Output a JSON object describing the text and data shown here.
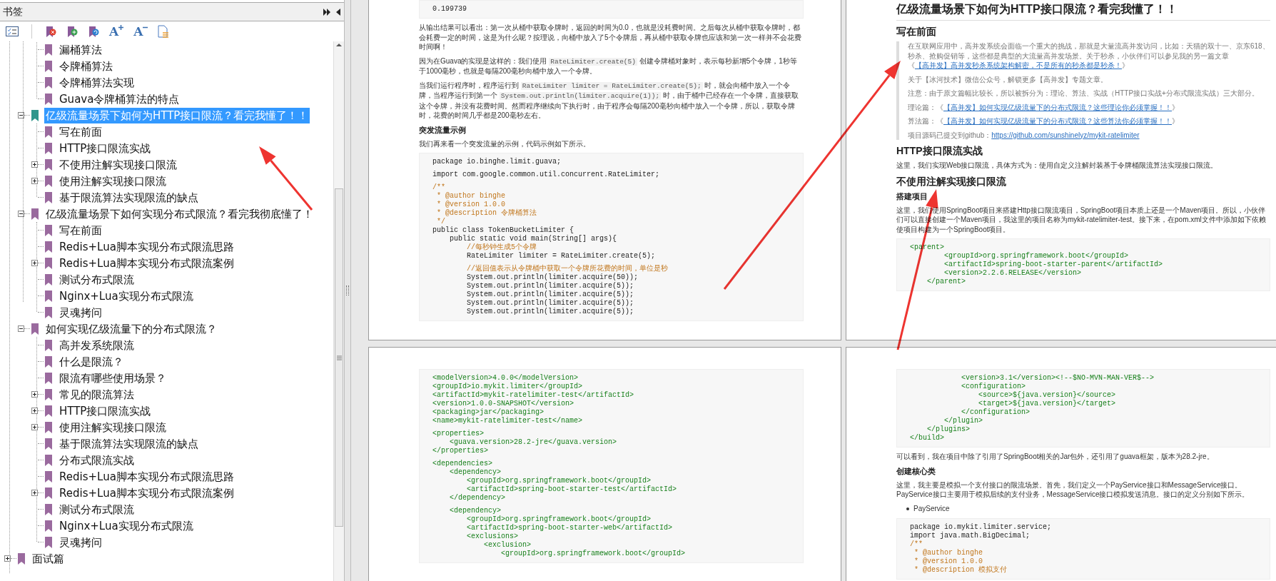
{
  "sidebar": {
    "title": "书签",
    "toolbar": {
      "font_larger_label": "A",
      "font_smaller_label": "A"
    }
  },
  "bookmarks": {
    "continued_items": [
      {
        "label": "漏桶算法",
        "selected": false
      },
      {
        "label": "令牌桶算法",
        "selected": false
      },
      {
        "label": "令牌桶算法实现",
        "selected": false
      },
      {
        "label": "Guava令牌桶算法的特点",
        "selected": false
      }
    ],
    "items": [
      {
        "label": "亿级流量场景下如何为HTTP接口限流？看完我懂了！！",
        "selected": true,
        "expanded": true,
        "children": [
          {
            "label": "写在前面",
            "selected": false
          },
          {
            "label": "HTTP接口限流实战",
            "selected": false
          },
          {
            "label": "不使用注解实现接口限流",
            "selected": false,
            "expanded": false
          },
          {
            "label": "使用注解实现接口限流",
            "selected": false,
            "expanded": false
          },
          {
            "label": "基于限流算法实现限流的缺点",
            "selected": false
          }
        ]
      },
      {
        "label": "亿级流量场景下如何实现分布式限流？看完我彻底懂了！",
        "selected": false,
        "expanded": true,
        "children": [
          {
            "label": "写在前面",
            "selected": false
          },
          {
            "label": "Redis+Lua脚本实现分布式限流思路",
            "selected": false
          },
          {
            "label": "Redis+Lua脚本实现分布式限流案例",
            "selected": false,
            "expanded": false
          },
          {
            "label": "测试分布式限流",
            "selected": false
          },
          {
            "label": "Nginx+Lua实现分布式限流",
            "selected": false
          },
          {
            "label": "灵魂拷问",
            "selected": false
          }
        ]
      },
      {
        "label": "如何实现亿级流量下的分布式限流？",
        "selected": false,
        "expanded": true,
        "children": [
          {
            "label": "高并发系统限流",
            "selected": false
          },
          {
            "label": "什么是限流？",
            "selected": false
          },
          {
            "label": "限流有哪些使用场景？",
            "selected": false
          },
          {
            "label": "常见的限流算法",
            "selected": false,
            "expanded": false
          },
          {
            "label": "HTTP接口限流实战",
            "selected": false,
            "expanded": false
          },
          {
            "label": "使用注解实现接口限流",
            "selected": false,
            "expanded": false
          },
          {
            "label": "基于限流算法实现限流的缺点",
            "selected": false
          },
          {
            "label": "分布式限流实战",
            "selected": false
          },
          {
            "label": "Redis+Lua脚本实现分布式限流思路",
            "selected": false
          },
          {
            "label": "Redis+Lua脚本实现分布式限流案例",
            "selected": false,
            "expanded": false
          },
          {
            "label": "测试分布式限流",
            "selected": false
          },
          {
            "label": "Nginx+Lua实现分布式限流",
            "selected": false
          },
          {
            "label": "灵魂拷问",
            "selected": false
          }
        ]
      }
    ],
    "outer_items": [
      {
        "label": "面试篇",
        "selected": false,
        "expanded": false
      }
    ]
  },
  "pages": [
    {
      "blocks": [
        {
          "kind": "code",
          "groups": [
            [
              {
                "text": "0.199739",
                "kind": "code"
              }
            ]
          ]
        },
        {
          "kind": "paragraph",
          "parts": [
            {
              "kind": "text",
              "text": "从输出结果可以看出：第一次从桶中获取令牌时，返回的时间为0.0，也就是没耗费时间。之后每次从桶中获取令牌时，都会耗费一定的时间，这是为什么呢？按理说，向桶中放入了5个令牌后，再从桶中获取令牌也应该和第一次一样并不会花费时间啊！"
            }
          ]
        },
        {
          "kind": "paragraph",
          "parts": [
            {
              "kind": "text",
              "text": "因为在Guava的实现是这样的：我们使用 "
            },
            {
              "kind": "code",
              "text": "RateLimiter.create(5)"
            },
            {
              "kind": "text",
              "text": " 创建令牌桶对象时，表示每秒新增5个令牌，1秒等于1000毫秒，也就是每隔200毫秒向桶中放入一个令牌。"
            }
          ]
        },
        {
          "kind": "paragraph",
          "parts": [
            {
              "kind": "text",
              "text": "当我们运行程序时，程序运行到 "
            },
            {
              "kind": "code",
              "text": "RateLimiter limiter = RateLimiter.create(5);"
            },
            {
              "kind": "text",
              "text": " 时，就会向桶中放入一个令牌，当程序运行到第一个 "
            },
            {
              "kind": "code",
              "text": "System.out.println(limiter.acquire(1));"
            },
            {
              "kind": "text",
              "text": " 时，由于桶中已经存在一个令牌，直接获取这个令牌，并没有花费时间。然而程序继续向下执行时，由于程序会每隔200毫秒向桶中放入一个令牌，所以，获取令牌时，花费的时间几乎都是200毫秒左右。"
            }
          ]
        },
        {
          "kind": "subheading",
          "text": "突发流量示例"
        },
        {
          "kind": "paragraph",
          "parts": [
            {
              "kind": "text",
              "text": "我们再来看一个突发流量的示例，代码示例如下所示。"
            }
          ]
        },
        {
          "kind": "code",
          "groups": [
            [
              {
                "text": "package io.binghe.limit.guava;",
                "kind": "code"
              }
            ],
            [
              {
                "text": "import com.google.common.util.concurrent.RateLimiter;",
                "kind": "code"
              }
            ],
            [
              {
                "text": "/**",
                "kind": "comment"
              },
              {
                "text": " * @author binghe",
                "kind": "comment"
              },
              {
                "text": " * @version 1.0.0",
                "kind": "comment"
              },
              {
                "text": " * @description 令牌桶算法",
                "kind": "comment"
              },
              {
                "text": " */",
                "kind": "comment"
              },
              {
                "text": "public class TokenBucketLimiter {",
                "kind": "code"
              },
              {
                "text": "    public static void main(String[] args){",
                "kind": "code"
              },
              {
                "text": "        //每秒钟生成5个令牌",
                "kind": "comment"
              },
              {
                "text": "        RateLimiter limiter = RateLimiter.create(5);",
                "kind": "code"
              }
            ],
            [
              {
                "text": "        //返回值表示从令牌桶中获取一个令牌所花费的时间，单位是秒",
                "kind": "comment"
              },
              {
                "text": "        System.out.println(limiter.acquire(50));",
                "kind": "code"
              },
              {
                "text": "        System.out.println(limiter.acquire(5));",
                "kind": "code"
              },
              {
                "text": "        System.out.println(limiter.acquire(5));",
                "kind": "code"
              },
              {
                "text": "        System.out.println(limiter.acquire(5));",
                "kind": "code"
              },
              {
                "text": "        System.out.println(limiter.acquire(5));",
                "kind": "code"
              }
            ]
          ]
        }
      ]
    },
    {
      "blocks": [
        {
          "kind": "title",
          "text": "亿级流量场景下如何为HTTP接口限流？看完我懂了！！"
        },
        {
          "kind": "heading",
          "text": "写在前面"
        },
        {
          "kind": "quote",
          "paragraphs": [
            {
              "parts": [
                {
                  "kind": "text",
                  "text": "在互联网应用中，高并发系统会面临一个重大的挑战，那就是大量流高并发访问，比如：天猫的双十一、京东618、秒杀、抢购促销等，这些都是典型的大流量高并发场景。关于秒杀，小伙伴们可以参见我的另一篇文章《"
                },
                {
                  "kind": "link",
                  "text": "【高并发】高并发秒杀系统架构解密，不是所有的秒杀都是秒杀！"
                },
                {
                  "kind": "text",
                  "text": "》"
                }
              ]
            },
            {
              "parts": [
                {
                  "kind": "text",
                  "text": "关于【冰河技术】微信公众号，解锁更多【高并发】专题文章。"
                }
              ]
            },
            {
              "parts": [
                {
                  "kind": "text",
                  "text": "注意：由于原文篇幅比较长，所以被拆分为：理论、算法、实战（HTTP接口实战+分布式限流实战）三大部分。"
                }
              ]
            },
            {
              "parts": [
                {
                  "kind": "text",
                  "text": "理论篇：《"
                },
                {
                  "kind": "link",
                  "text": "【高并发】如何实现亿级流量下的分布式限流？这些理论你必须掌握！！"
                },
                {
                  "kind": "text",
                  "text": "》"
                }
              ]
            },
            {
              "parts": [
                {
                  "kind": "text",
                  "text": "算法篇：《"
                },
                {
                  "kind": "link",
                  "text": "【高并发】如何实现亿级流量下的分布式限流？这些算法你必须掌握！！"
                },
                {
                  "kind": "text",
                  "text": "》"
                }
              ]
            },
            {
              "parts": [
                {
                  "kind": "text",
                  "text": "项目源码已提交到github："
                },
                {
                  "kind": "link",
                  "text": "https://github.com/sunshinelyz/mykit-ratelimiter"
                }
              ]
            }
          ]
        },
        {
          "kind": "heading",
          "text": "HTTP接口限流实战"
        },
        {
          "kind": "paragraph",
          "parts": [
            {
              "kind": "text",
              "text": "这里，我们实现Web接口限流，具体方式为：使用自定义注解封装基于令牌桶限流算法实现接口限流。"
            }
          ]
        },
        {
          "kind": "heading",
          "text": "不使用注解实现接口限流"
        },
        {
          "kind": "subheading",
          "text": "搭建项目"
        },
        {
          "kind": "paragraph",
          "parts": [
            {
              "kind": "text",
              "text": "这里，我们使用SpringBoot项目来搭建Http接口限流项目，SpringBoot项目本质上还是一个Maven项目。所以，小伙伴们可以直接创建一个Maven项目，我这里的项目名称为mykit-ratelimiter-test。接下来，在pom.xml文件中添加如下依赖使项目构建为一个SpringBoot项目。"
            }
          ]
        },
        {
          "kind": "code",
          "groups": [
            [
              {
                "text": "<parent>",
                "kind": "xml"
              },
              {
                "text": "        <groupId>org.springframework.boot</groupId>",
                "kind": "xml"
              },
              {
                "text": "        <artifactId>spring-boot-starter-parent</artifactId>",
                "kind": "xml"
              },
              {
                "text": "        <version>2.2.6.RELEASE</version>",
                "kind": "xml"
              },
              {
                "text": "    </parent>",
                "kind": "xml"
              }
            ]
          ]
        }
      ]
    },
    {
      "blocks": [
        {
          "kind": "code",
          "groups": [
            [
              {
                "text": "<modelVersion>4.0.0</modelVersion>",
                "kind": "xml"
              },
              {
                "text": "<groupId>io.mykit.limiter</groupId>",
                "kind": "xml"
              },
              {
                "text": "<artifactId>mykit-ratelimiter-test</artifactId>",
                "kind": "xml"
              },
              {
                "text": "<version>1.0.0-SNAPSHOT</version>",
                "kind": "xml"
              },
              {
                "text": "<packaging>jar</packaging>",
                "kind": "xml"
              },
              {
                "text": "<name>mykit-ratelimiter-test</name>",
                "kind": "xml"
              }
            ],
            [
              {
                "text": "<properties>",
                "kind": "xml"
              },
              {
                "text": "    <guava.version>28.2-jre</guava.version>",
                "kind": "xml"
              },
              {
                "text": "</properties>",
                "kind": "xml"
              }
            ],
            [
              {
                "text": "<dependencies>",
                "kind": "xml"
              },
              {
                "text": "    <dependency>",
                "kind": "xml"
              },
              {
                "text": "        <groupId>org.springframework.boot</groupId>",
                "kind": "xml"
              },
              {
                "text": "        <artifactId>spring-boot-starter-test</artifactId>",
                "kind": "xml"
              },
              {
                "text": "    </dependency>",
                "kind": "xml"
              }
            ],
            [
              {
                "text": "    <dependency>",
                "kind": "xml"
              },
              {
                "text": "        <groupId>org.springframework.boot</groupId>",
                "kind": "xml"
              },
              {
                "text": "        <artifactId>spring-boot-starter-web</artifactId>",
                "kind": "xml"
              },
              {
                "text": "        <exclusions>",
                "kind": "xml"
              },
              {
                "text": "            <exclusion>",
                "kind": "xml"
              },
              {
                "text": "                <groupId>org.springframework.boot</groupId>",
                "kind": "xml"
              }
            ]
          ]
        }
      ]
    },
    {
      "blocks": [
        {
          "kind": "code",
          "groups": [
            [
              {
                "text": "            <version>3.1</version><!--$NO-MVN-MAN-VER$-->",
                "kind": "xml"
              },
              {
                "text": "            <configuration>",
                "kind": "xml"
              },
              {
                "text": "                <source>${java.version}</source>",
                "kind": "xml"
              },
              {
                "text": "                <target>${java.version}</target>",
                "kind": "xml"
              },
              {
                "text": "            </configuration>",
                "kind": "xml"
              },
              {
                "text": "        </plugin>",
                "kind": "xml"
              },
              {
                "text": "    </plugins>",
                "kind": "xml"
              },
              {
                "text": "</build>",
                "kind": "xml"
              }
            ]
          ]
        },
        {
          "kind": "paragraph",
          "parts": [
            {
              "kind": "text",
              "text": "可以看到，我在项目中除了引用了SpringBoot相关的Jar包外，还引用了guava框架，版本为28.2-jre。"
            }
          ]
        },
        {
          "kind": "subheading",
          "text": "创建核心类"
        },
        {
          "kind": "paragraph",
          "parts": [
            {
              "kind": "text",
              "text": "这里，我主要是模拟一个支付接口的限流场景。首先，我们定义一个PayService接口和MessageService接口。PayService接口主要用于模拟后续的支付业务，MessageService接口模拟发送消息。接口的定义分别如下所示。"
            }
          ]
        },
        {
          "kind": "bullet",
          "text": "PayService"
        },
        {
          "kind": "code",
          "groups": [
            [
              {
                "text": "package io.mykit.limiter.service;",
                "kind": "code"
              },
              {
                "text": "import java.math.BigDecimal;",
                "kind": "code"
              },
              {
                "text": "/**",
                "kind": "comment"
              },
              {
                "text": " * @author binghe",
                "kind": "comment"
              },
              {
                "text": " * @version 1.0.0",
                "kind": "comment"
              },
              {
                "text": " * @description 模拟支付",
                "kind": "comment"
              }
            ]
          ]
        }
      ]
    }
  ]
}
